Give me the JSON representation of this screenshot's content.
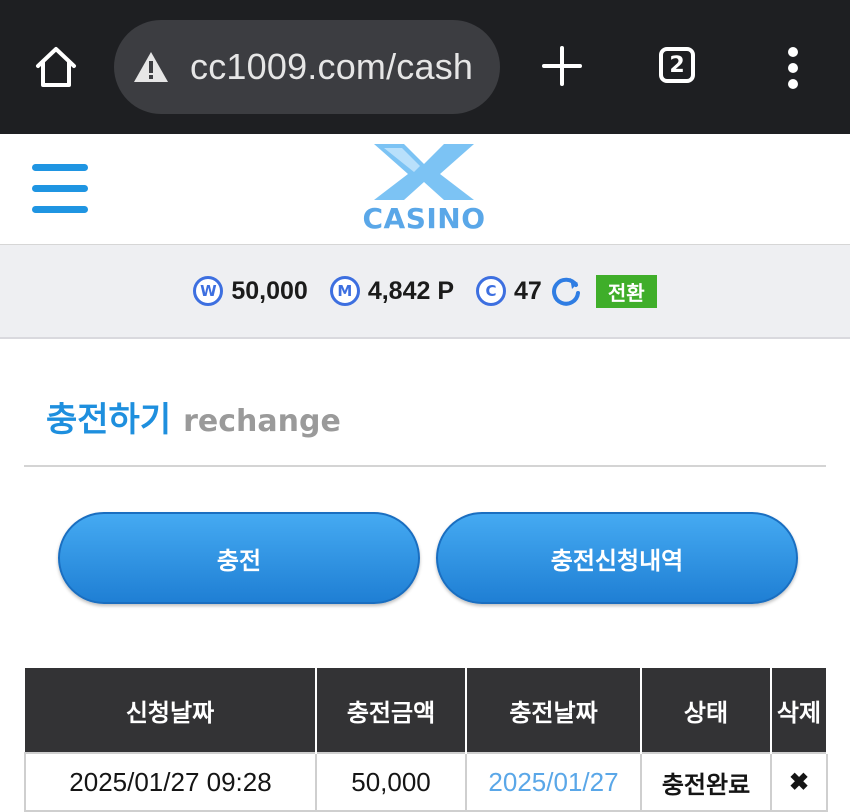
{
  "browser": {
    "url": "cc1009.com/cash",
    "tab_count": "2"
  },
  "header": {
    "logo_text": "CASINO",
    "logo_color": "#5aa7e8",
    "menu_icon": "hamburger-icon"
  },
  "balance": {
    "won": {
      "icon": "W",
      "value": "50,000"
    },
    "mileage": {
      "icon": "M",
      "value": "4,842 P"
    },
    "coin": {
      "icon": "C",
      "value": "47"
    },
    "convert_label": "전환"
  },
  "section": {
    "title_ko": "충전하기",
    "title_en": "rechange"
  },
  "buttons": {
    "charge": "충전",
    "history": "충전신청내역"
  },
  "table": {
    "headers": [
      "신청날짜",
      "충전금액",
      "충전날짜",
      "상태",
      "삭제"
    ],
    "rows": [
      {
        "request_date": "2025/01/27 09:28",
        "amount": "50,000",
        "charge_date": "2025/01/27",
        "status": "충전완료",
        "delete": "✖"
      }
    ]
  },
  "colors": {
    "accent": "#1f95e2",
    "convert_badge": "#3fae2a",
    "table_header": "#333335"
  }
}
